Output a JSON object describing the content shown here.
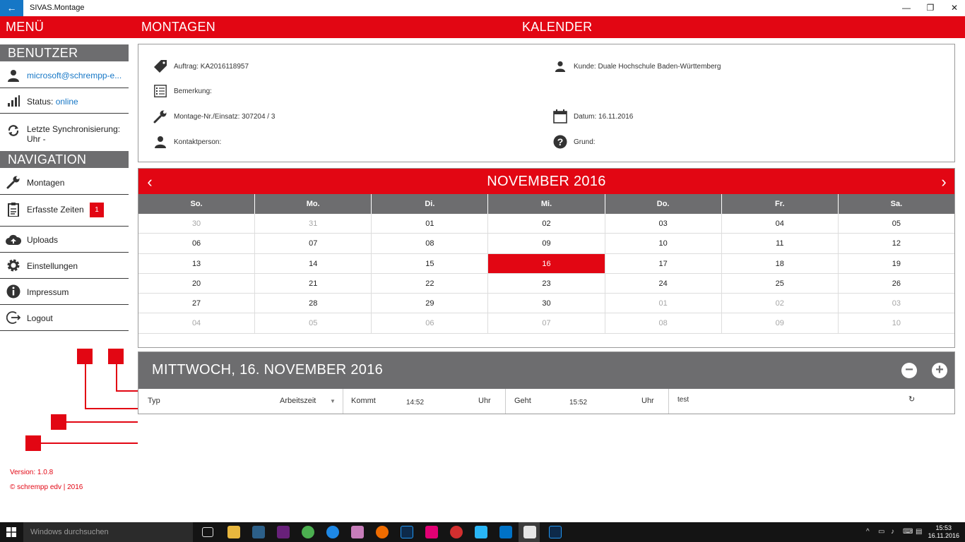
{
  "window": {
    "title": "SIVAS.Montage",
    "back": "←",
    "minimize": "—",
    "restore": "❐",
    "close": "✕"
  },
  "header": {
    "menu": "MENÜ",
    "montagen": "MONTAGEN",
    "kalender": "KALENDER"
  },
  "sidebar": {
    "benutzer_head": "BENUTZER",
    "user": "microsoft@schrempp-e...",
    "status_label": "Status: ",
    "status_value": "online",
    "sync_label": "Letzte Synchronisierung:",
    "sync_value": "Uhr -",
    "nav_head": "NAVIGATION",
    "nav": [
      {
        "label": "Montagen",
        "icon": "wrench-icon"
      },
      {
        "label": "Erfasste Zeiten",
        "icon": "clipboard-icon",
        "badge": "1"
      },
      {
        "label": "Uploads",
        "icon": "cloud-upload-icon"
      },
      {
        "label": "Einstellungen",
        "icon": "gear-icon"
      },
      {
        "label": "Impressum",
        "icon": "info-icon"
      },
      {
        "label": "Logout",
        "icon": "logout-icon"
      }
    ],
    "version": "Version: 1.0.8",
    "copyright": "© schrempp edv | 2016"
  },
  "info": {
    "auftrag": "Auftrag: KA2016118957",
    "bemerkung": "Bemerkung:",
    "montage_nr": "Montage-Nr./Einsatz: 307204 / 3",
    "kontakt": "Kontaktperson:",
    "kunde": "Kunde: Duale Hochschule Baden-Württemberg",
    "datum": "Datum: 16.11.2016",
    "grund": "Grund:"
  },
  "calendar": {
    "month": "NOVEMBER 2016",
    "prev": "‹",
    "next": "›",
    "weekdays": [
      "So.",
      "Mo.",
      "Di.",
      "Mi.",
      "Do.",
      "Fr.",
      "Sa."
    ],
    "weeks": [
      [
        "30",
        "31",
        "01",
        "02",
        "03",
        "04",
        "05"
      ],
      [
        "06",
        "07",
        "08",
        "09",
        "10",
        "11",
        "12"
      ],
      [
        "13",
        "14",
        "15",
        "16",
        "17",
        "18",
        "19"
      ],
      [
        "20",
        "21",
        "22",
        "23",
        "24",
        "25",
        "26"
      ],
      [
        "27",
        "28",
        "29",
        "30",
        "01",
        "02",
        "03"
      ],
      [
        "04",
        "05",
        "06",
        "07",
        "08",
        "09",
        "10"
      ]
    ],
    "selected": "16"
  },
  "day": {
    "title": "MITTWOCH, 16. NOVEMBER 2016",
    "minus": "−",
    "plus": "+",
    "typ_label": "Typ",
    "typ_value": "Arbeitszeit",
    "kommt_label": "Kommt",
    "kommt_value": "14:52",
    "kommt_unit": "Uhr",
    "geht_label": "Geht",
    "geht_value": "15:52",
    "geht_unit": "Uhr",
    "note": "test"
  },
  "taskbar": {
    "search_placeholder": "Windows durchsuchen",
    "time": "15:53",
    "date": "16.11.2016"
  }
}
